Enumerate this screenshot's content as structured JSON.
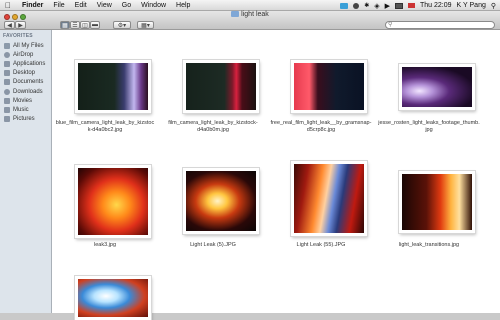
{
  "menubar": {
    "app": "Finder",
    "menus": [
      "File",
      "Edit",
      "View",
      "Go",
      "Window",
      "Help"
    ],
    "clock": "Thu 22:09",
    "user": "K Y Pang"
  },
  "window": {
    "title": "light leak"
  },
  "sidebar": {
    "heading": "FAVORITES",
    "items": [
      "All My Files",
      "AirDrop",
      "Applications",
      "Desktop",
      "Documents",
      "Downloads",
      "Movies",
      "Music",
      "Pictures"
    ]
  },
  "files": [
    {
      "caption1": "blue_film_camera_light_leak_by_kizstoc",
      "caption2": "k-d4a0bc2.jpg",
      "thumb": "blue-film-leak"
    },
    {
      "caption1": "film_camera_light_leak_by_kizstock-",
      "caption2": "d4a0b0m.jpg",
      "thumb": "red-stripe-leak"
    },
    {
      "caption1": "free_real_film_light_leak__by_gramsnap-",
      "caption2": "d5crp8c.jpg",
      "thumb": "pink-red-leak"
    },
    {
      "caption1": "jesse_rosten_light_leaks_footage_thumb.",
      "caption2": "jpg",
      "thumb": "purple-leak"
    },
    {
      "caption1": "leak3.jpg",
      "caption2": "",
      "thumb": "orange-fire-leak"
    },
    {
      "caption1": "Light Leak (5).JPG",
      "caption2": "",
      "thumb": "yellow-glow-leak"
    },
    {
      "caption1": "Light Leak (55).JPG",
      "caption2": "",
      "thumb": "blue-orange-leak"
    },
    {
      "caption1": "light_leak_transitions.jpg",
      "caption2": "",
      "thumb": "sunset-leak"
    },
    {
      "caption1": "",
      "caption2": "",
      "thumb": "white-blue-leak"
    }
  ]
}
